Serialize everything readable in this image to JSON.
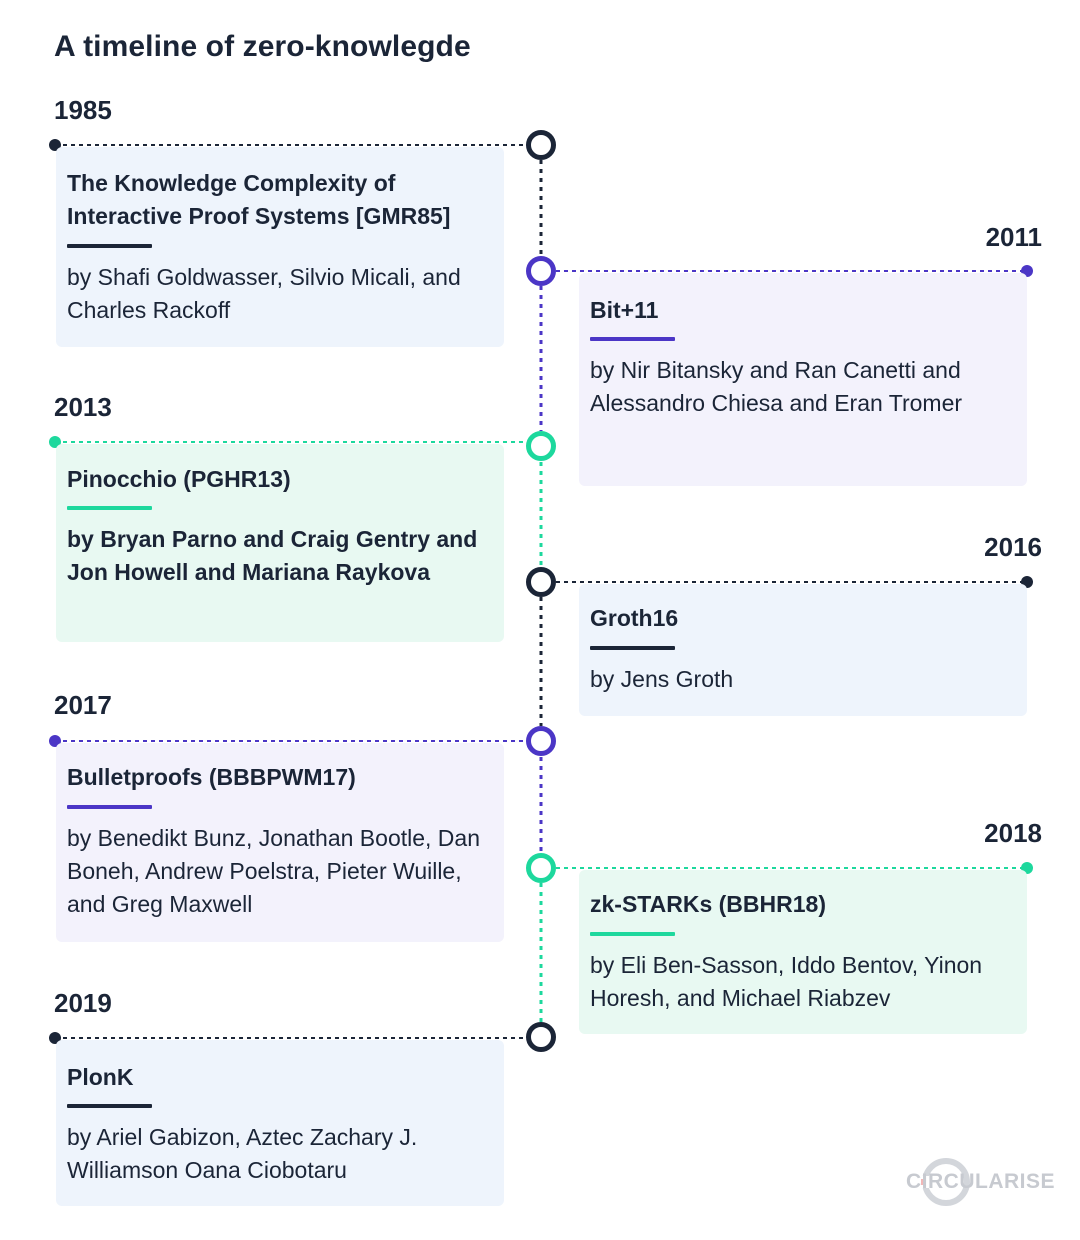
{
  "title": "A timeline of zero-knowlegde",
  "colors": {
    "navy": "#1b2537",
    "purple": "#4b36c6",
    "green": "#1dd89d",
    "card_navy": "#eef4fc",
    "card_purple": "#f3f2fc",
    "card_green": "#e8f9f2"
  },
  "events": [
    {
      "year": "1985",
      "side": "left",
      "color": "navy",
      "title": "The Knowledge Complexity of Interactive Proof Systems [GMR85]",
      "authors": "by Shafi Goldwasser, Silvio Micali, and Charles Rackoff"
    },
    {
      "year": "2011",
      "side": "right",
      "color": "purple",
      "title": "Bit+11",
      "authors": "by Nir Bitansky and Ran Canetti and Alessandro Chiesa and Eran Tromer"
    },
    {
      "year": "2013",
      "side": "left",
      "color": "green",
      "title": "Pinocchio (PGHR13)",
      "authors": "by Bryan Parno and Craig Gentry and Jon Howell and Mariana Raykova"
    },
    {
      "year": "2016",
      "side": "right",
      "color": "navy",
      "title": "Groth16",
      "authors": "by Jens Groth"
    },
    {
      "year": "2017",
      "side": "left",
      "color": "purple",
      "title": "Bulletproofs (BBBPWM17)",
      "authors": "by Benedikt Bunz, Jonathan Bootle, Dan Boneh, Andrew Poelstra, Pieter Wuille, and Greg Maxwell"
    },
    {
      "year": "2018",
      "side": "right",
      "color": "green",
      "title": "zk-STARKs (BBHR18)",
      "authors": "by Eli Ben-Sasson, Iddo Bentov, Yinon Horesh, and Michael Riabzev"
    },
    {
      "year": "2019",
      "side": "left",
      "color": "navy",
      "title": "PlonK",
      "authors": "by Ariel Gabizon, Aztec Zachary J. Williamson Oana Ciobotaru"
    }
  ],
  "logo": {
    "text": "CIRCULARISE",
    "icon": "circularise-logo-icon"
  }
}
